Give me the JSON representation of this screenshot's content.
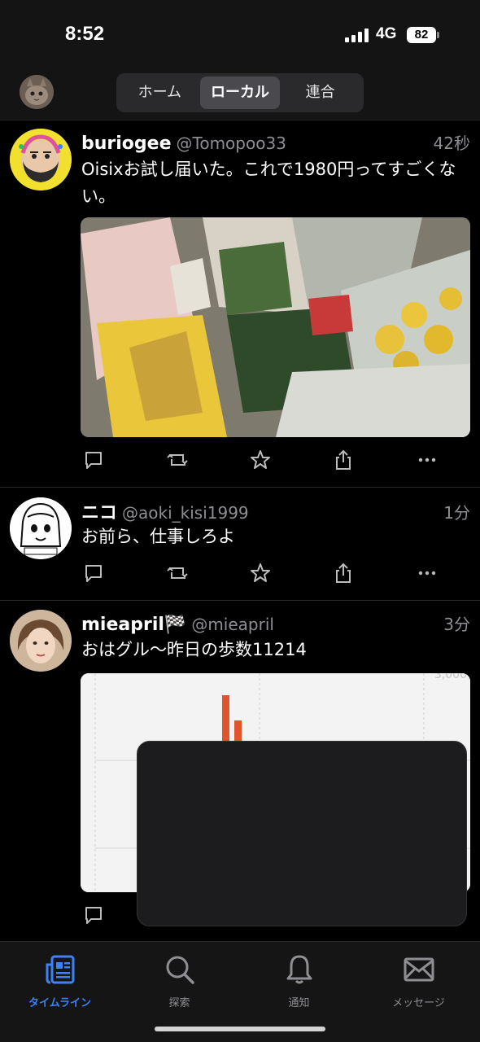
{
  "status_bar": {
    "time": "8:52",
    "network": "4G",
    "battery": "82"
  },
  "header": {
    "segments": [
      {
        "label": "ホーム",
        "active": false
      },
      {
        "label": "ローカル",
        "active": true
      },
      {
        "label": "連合",
        "active": false
      }
    ]
  },
  "posts": [
    {
      "display_name": "buriogee",
      "handle": "@Tomopoo33",
      "time": "42秒",
      "text": "Oisixお試し届いた。これで1980円ってすごくない。"
    },
    {
      "display_name": "ニコ",
      "handle": "@aoki_kisi1999",
      "time": "1分",
      "text": "お前ら、仕事しろよ"
    },
    {
      "display_name": "mieapril🏁",
      "handle": "@mieapril",
      "time": "3分",
      "text": "おはグル〜昨日の歩数11214",
      "chart_axis_label": "3,000"
    }
  ],
  "tabbar": {
    "tabs": [
      {
        "label": "タイムライン",
        "icon": "timeline-icon",
        "active": true
      },
      {
        "label": "探索",
        "icon": "search-icon",
        "active": false
      },
      {
        "label": "通知",
        "icon": "bell-icon",
        "active": false
      },
      {
        "label": "メッセージ",
        "icon": "mail-icon",
        "active": false
      }
    ]
  },
  "colors": {
    "accent": "#3b82f6",
    "background": "#000000",
    "secondary_text": "#8e8e93"
  }
}
